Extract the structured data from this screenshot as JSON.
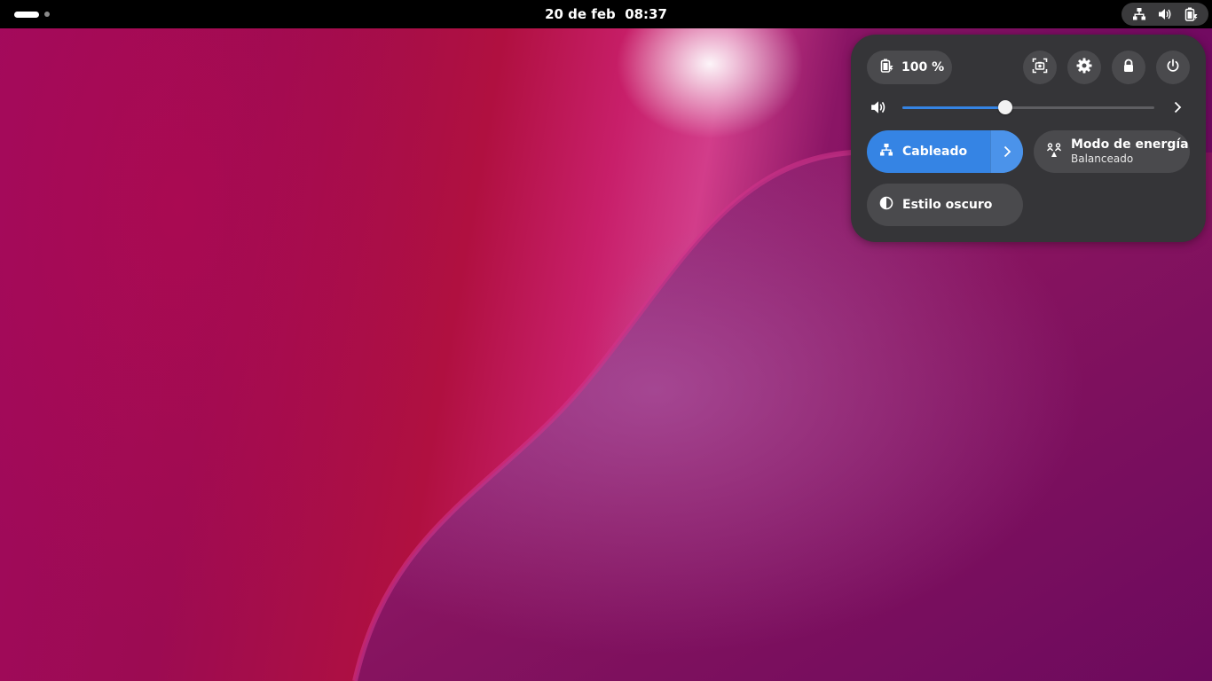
{
  "topbar": {
    "clock_date": "20 de feb",
    "clock_time": "08:37"
  },
  "quick_settings": {
    "battery_label": "100 %",
    "volume_level": 0.41,
    "network": {
      "label": "Cableado",
      "active": true
    },
    "power_mode": {
      "label": "Modo de energía",
      "value": "Balanceado"
    },
    "dark_style": {
      "label": "Estilo oscuro",
      "active": false
    }
  },
  "icons": {
    "topbar_status": [
      "network-wired-icon",
      "volume-icon",
      "battery-icon"
    ],
    "system_buttons": [
      "screenshot-icon",
      "settings-icon",
      "lock-icon",
      "power-icon"
    ]
  },
  "colors": {
    "accent": "#3584e4",
    "panel_bg": "#353538",
    "button_bg": "#4a4a4d",
    "topbar_bg": "#000000"
  }
}
